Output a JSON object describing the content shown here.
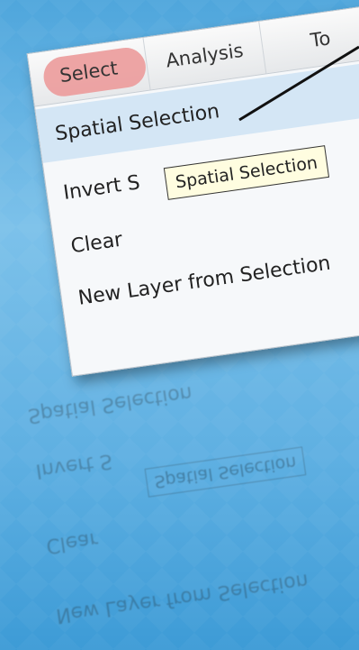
{
  "menubar": {
    "tabs": [
      {
        "label": "Select",
        "active": true,
        "highlight_color": "#ec9f9f"
      },
      {
        "label": "Analysis",
        "active": false
      },
      {
        "label": "To",
        "active": false
      }
    ]
  },
  "menu": {
    "items": [
      {
        "label": "Spatial Selection",
        "highlighted": true
      },
      {
        "label": "Invert S",
        "highlighted": false
      },
      {
        "label": "Clear",
        "highlighted": false
      },
      {
        "label": "New Layer from Selection",
        "highlighted": false
      }
    ]
  },
  "tooltip": {
    "text": "Spatial Selection"
  },
  "colors": {
    "background_top": "#4fa6dc",
    "highlight_row": "#d4e6f5",
    "tooltip_bg": "#fffde0"
  }
}
